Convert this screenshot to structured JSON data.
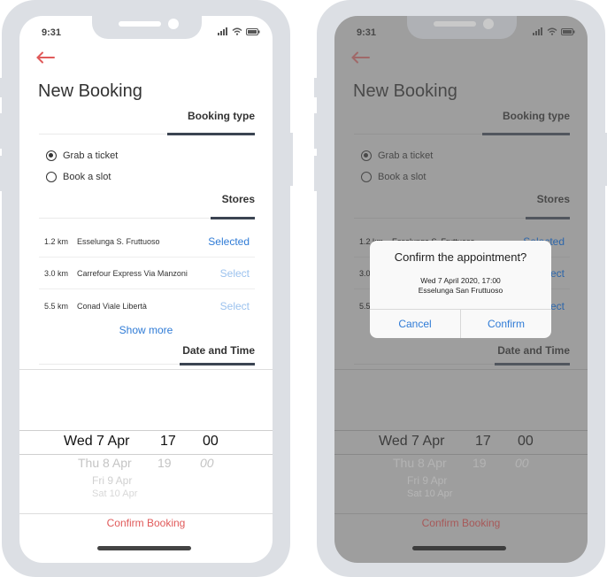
{
  "status": {
    "time": "9:31"
  },
  "page": {
    "title": "New Booking"
  },
  "sections": {
    "booking_type": "Booking type",
    "stores": "Stores",
    "date_time": "Date and Time"
  },
  "booking_options": [
    {
      "label": "Grab a ticket",
      "checked": true
    },
    {
      "label": "Book a slot",
      "checked": false
    }
  ],
  "stores": [
    {
      "distance": "1.2 km",
      "name": "Esselunga S. Fruttuoso",
      "action": "Selected"
    },
    {
      "distance": "3.0 km",
      "name": "Carrefour Express Via Manzoni",
      "action": "Select"
    },
    {
      "distance": "5.5 km",
      "name": "Conad Viale Libertà",
      "action": "Select"
    }
  ],
  "show_more": "Show more",
  "picker": [
    {
      "date": "Wed 7 Apr",
      "hour": "17",
      "minute": "00"
    },
    {
      "date": "Thu 8 Apr",
      "hour": "19",
      "minute": "00"
    },
    {
      "date": "Fri 9 Apr",
      "hour": "",
      "minute": ""
    },
    {
      "date": "Sat 10 Apr",
      "hour": "",
      "minute": ""
    }
  ],
  "confirm_booking": "Confirm Booking",
  "dialog": {
    "title": "Confirm the appointment?",
    "line1": "Wed 7 April 2020, 17:00",
    "line2": "Esselunga San Fruttuoso",
    "cancel": "Cancel",
    "confirm": "Confirm"
  },
  "colors": {
    "accent_red": "#e05a5a",
    "link_blue": "#2f7bd6",
    "dark_accent": "#3b4452"
  },
  "icons": [
    "back-arrow-icon",
    "signal-icon",
    "wifi-icon",
    "battery-icon"
  ]
}
